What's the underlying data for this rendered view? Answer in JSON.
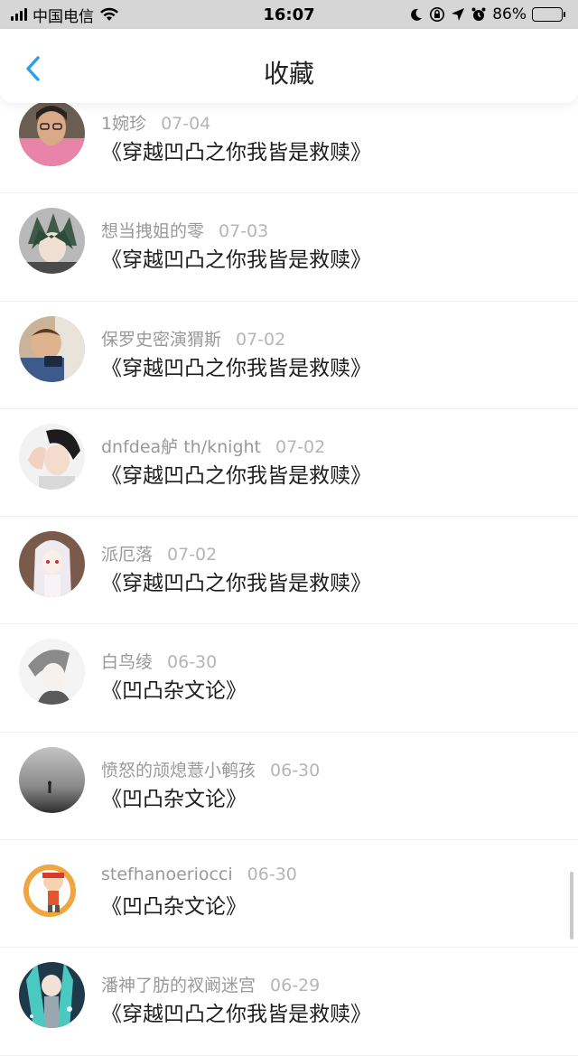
{
  "status_bar": {
    "carrier": "中国电信",
    "time": "16:07",
    "battery": "86%",
    "battery_level": 0.86
  },
  "header": {
    "title": "收藏",
    "back_icon": "chevron-left-icon",
    "accent_color": "#2f9fe8"
  },
  "items": [
    {
      "user": "1婉珍",
      "date": "07-04",
      "title": "《穿越凹凸之你我皆是救赎》"
    },
    {
      "user": "想当拽姐的零",
      "date": "07-03",
      "title": "《穿越凹凸之你我皆是救赎》"
    },
    {
      "user": "保罗史密演猬斯",
      "date": "07-02",
      "title": "《穿越凹凸之你我皆是救赎》"
    },
    {
      "user": "dnfdea舻 th/knight",
      "date": "07-02",
      "title": "《穿越凹凸之你我皆是救赎》"
    },
    {
      "user": "派厄落",
      "date": "07-02",
      "title": "《穿越凹凸之你我皆是救赎》"
    },
    {
      "user": "白鸟绫",
      "date": "06-30",
      "title": "《凹凸杂文论》"
    },
    {
      "user": "愤怒的颃熄薏小鹌孩",
      "date": "06-30",
      "title": "《凹凸杂文论》"
    },
    {
      "user": "stefhanoeriocci",
      "date": "06-30",
      "title": "《凹凸杂文论》"
    },
    {
      "user": "潘神了肪的衩阚迷宫",
      "date": "06-29",
      "title": "《穿越凹凸之你我皆是救赎》"
    }
  ]
}
